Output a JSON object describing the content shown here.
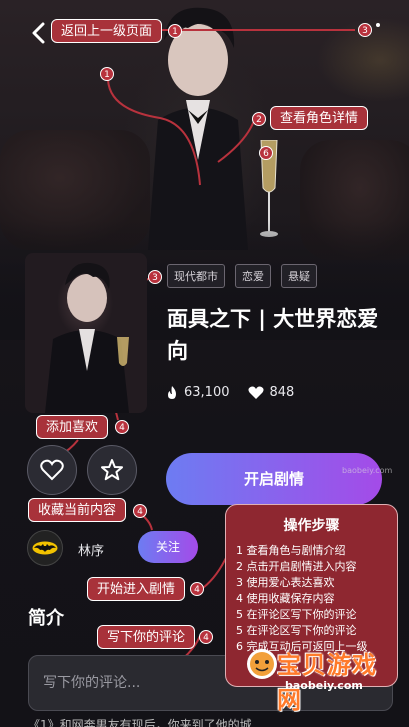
{
  "header": {
    "back_label": "返回上一级页面",
    "more_label": "3"
  },
  "callouts": {
    "back": "返回上一级页面",
    "detail": "查看角色详情",
    "like": "添加喜欢",
    "collect": "收藏当前内容",
    "start": "开始进入剧情",
    "comment": "写下你的评论"
  },
  "markers": {
    "m1a": "1",
    "m1b": "1",
    "m2": "2",
    "m3": "3",
    "m3b": "3",
    "m4a": "4",
    "m4b": "4",
    "m4c": "4",
    "m4d": "4",
    "m6": "6"
  },
  "story": {
    "tags": [
      "现代都市",
      "恋爱",
      "悬疑"
    ],
    "title": "面具之下 | 大世界恋爱向",
    "views": "63,100",
    "likes": "848"
  },
  "actions": {
    "start_label": "开启剧情"
  },
  "author": {
    "name": "林序",
    "follow_label": "关注"
  },
  "intro": {
    "section_title": "简介",
    "comment_placeholder": "写下你的评论...",
    "snippet": "《1》和网奔男友有现后，你来到了他的城"
  },
  "steps": {
    "title": "操作步骤",
    "items": [
      "1 查看角色与剧情介绍",
      "2 点击开启剧情进入内容",
      "3 使用爱心表达喜欢",
      "4 使用收藏保存内容",
      "5 在评论区写下你的评论",
      "5 在评论区写下你的评论",
      "6 完成互动后可返回上一级"
    ]
  },
  "watermark": {
    "text": "宝贝游戏网",
    "url": "baobeiy.com",
    "url_small": "baobeiy.com"
  },
  "colors": {
    "accent_start": "#6d7cf2",
    "accent_end": "#a44be8",
    "callout_red": "#a8323a",
    "background": "#131217"
  }
}
